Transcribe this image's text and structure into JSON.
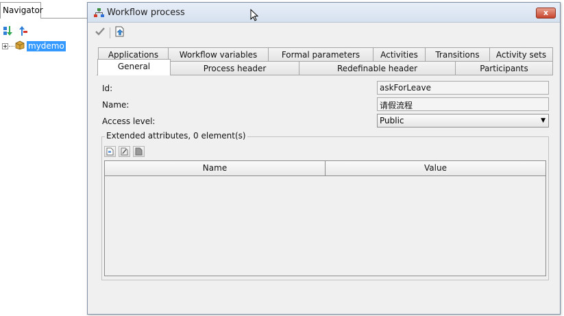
{
  "navigator": {
    "tab_label": "Navigator",
    "tree_item": "mydemo"
  },
  "dialog": {
    "title": "Workflow process",
    "close_label": "x",
    "tabs_row1": [
      "Applications",
      "Workflow variables",
      "Formal parameters",
      "Activities",
      "Transitions",
      "Activity sets"
    ],
    "tabs_row2": [
      "General",
      "Process header",
      "Redefinable header",
      "Participants"
    ],
    "active_tab": "General",
    "fields": {
      "id_label": "Id:",
      "id_value": "askForLeave",
      "name_label": "Name:",
      "name_value": "请假流程",
      "access_label": "Access level:",
      "access_value": "Public"
    },
    "extended": {
      "label": "Extended attributes, 0 element(s)",
      "columns": [
        "Name",
        "Value"
      ]
    }
  },
  "colors": {
    "selection": "#3399ff",
    "close_button": "#c7442e"
  }
}
